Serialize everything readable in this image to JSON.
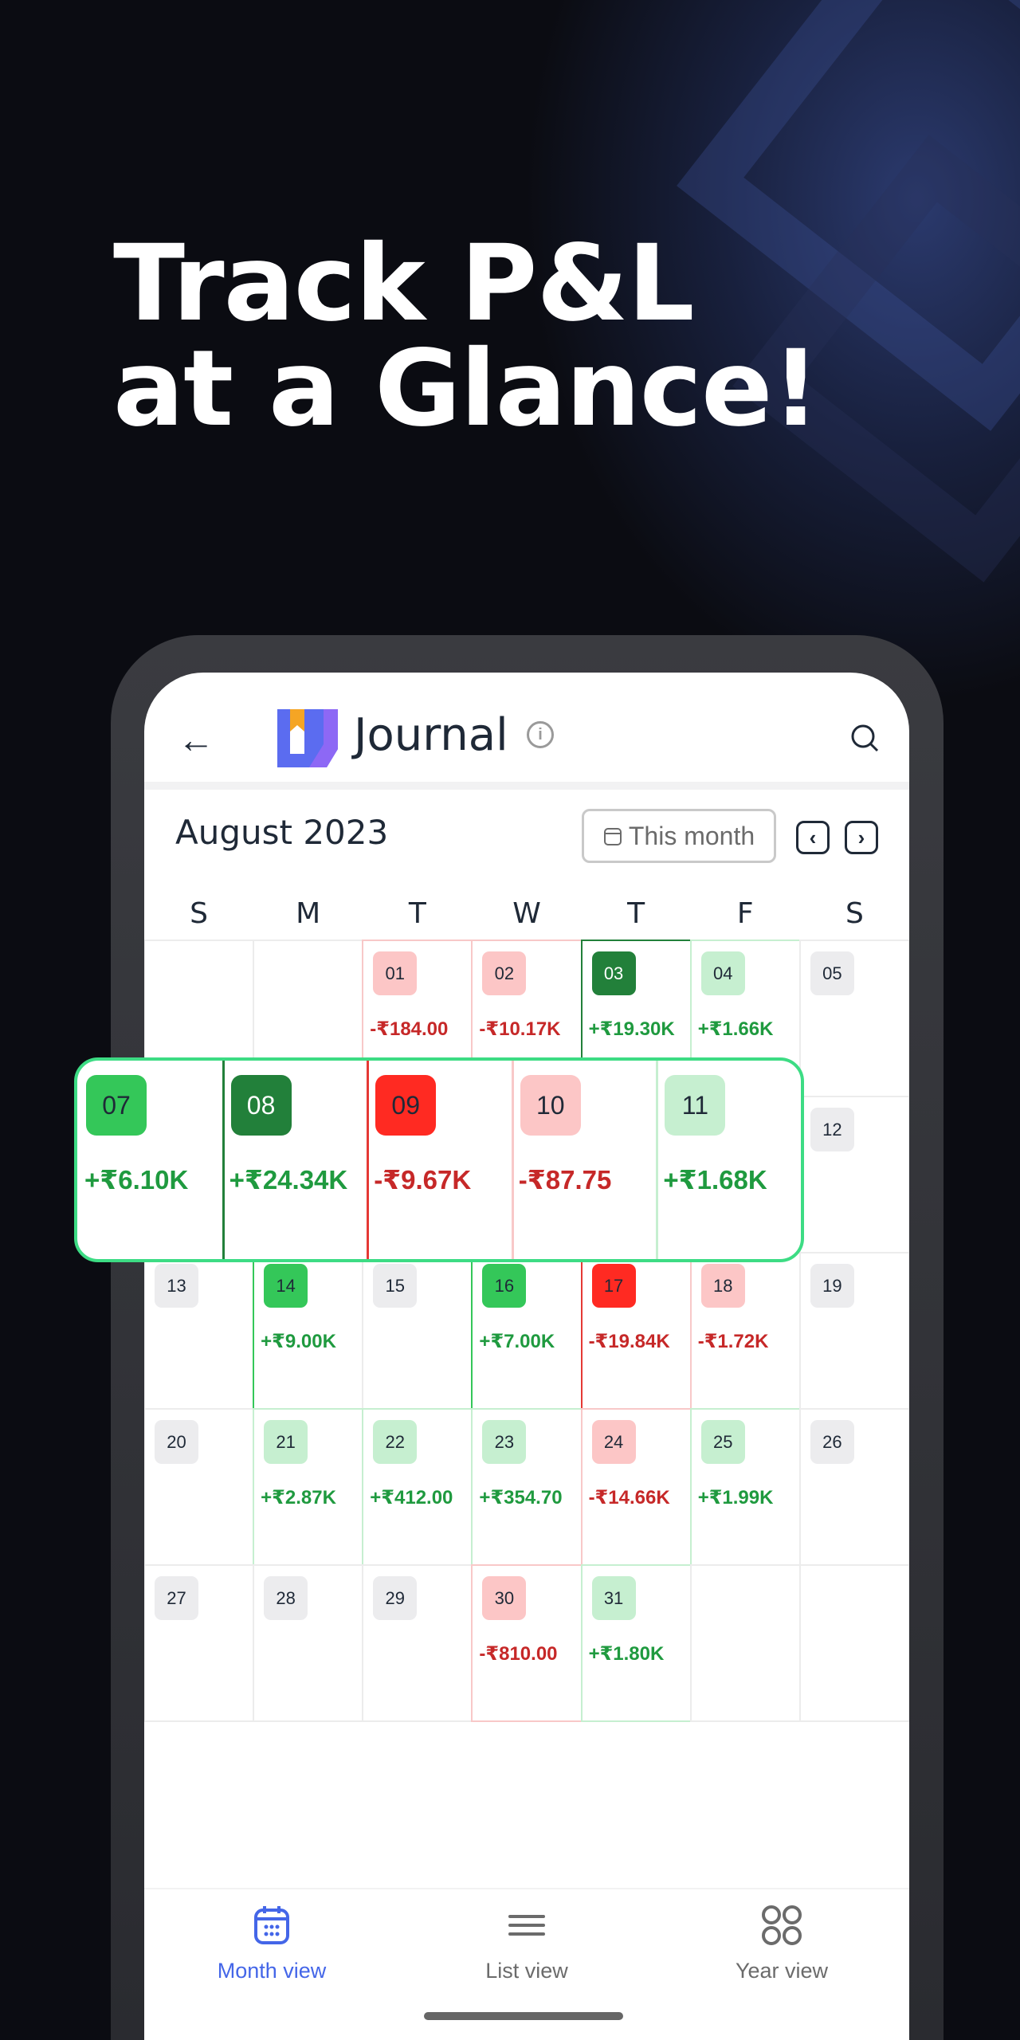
{
  "headline": {
    "line1": "Track P&L",
    "line2": "at a Glance!"
  },
  "header": {
    "title": "Journal",
    "back_icon": "arrow-left-icon",
    "info_icon": "info-icon",
    "search_icon": "search-icon"
  },
  "calendar": {
    "month_label": "August 2023",
    "this_month_label": "This month",
    "weekdays": [
      "S",
      "M",
      "T",
      "W",
      "T",
      "F",
      "S"
    ],
    "colors": {
      "positive": "#1f9a3f",
      "negative": "#c62828"
    },
    "weeks": [
      [
        null,
        null,
        {
          "day": "01",
          "pnl": "-₹184.00",
          "tone": "neg-light"
        },
        {
          "day": "02",
          "pnl": "-₹10.17K",
          "tone": "neg-light"
        },
        {
          "day": "03",
          "pnl": "+₹19.30K",
          "tone": "pos-strong"
        },
        {
          "day": "04",
          "pnl": "+₹1.66K",
          "tone": "pos-light"
        },
        {
          "day": "05",
          "tone": "none"
        }
      ],
      [
        {
          "tone": "hidden"
        },
        {
          "tone": "hidden"
        },
        {
          "tone": "hidden"
        },
        {
          "tone": "hidden"
        },
        {
          "tone": "hidden"
        },
        {
          "tone": "hidden"
        },
        {
          "day": "12",
          "tone": "none"
        }
      ],
      [
        {
          "day": "13",
          "tone": "none"
        },
        {
          "day": "14",
          "pnl": "+₹9.00K",
          "tone": "pos"
        },
        {
          "day": "15",
          "tone": "none"
        },
        {
          "day": "16",
          "pnl": "+₹7.00K",
          "tone": "pos"
        },
        {
          "day": "17",
          "pnl": "-₹19.84K",
          "tone": "neg"
        },
        {
          "day": "18",
          "pnl": "-₹1.72K",
          "tone": "neg-light"
        },
        {
          "day": "19",
          "tone": "none"
        }
      ],
      [
        {
          "day": "20",
          "tone": "none"
        },
        {
          "day": "21",
          "pnl": "+₹2.87K",
          "tone": "pos-light"
        },
        {
          "day": "22",
          "pnl": "+₹412.00",
          "tone": "pos-light"
        },
        {
          "day": "23",
          "pnl": "+₹354.70",
          "tone": "pos-light"
        },
        {
          "day": "24",
          "pnl": "-₹14.66K",
          "tone": "neg-light"
        },
        {
          "day": "25",
          "pnl": "+₹1.99K",
          "tone": "pos-light"
        },
        {
          "day": "26",
          "tone": "none"
        }
      ],
      [
        {
          "day": "27",
          "tone": "none"
        },
        {
          "day": "28",
          "tone": "none"
        },
        {
          "day": "29",
          "tone": "none"
        },
        {
          "day": "30",
          "pnl": "-₹810.00",
          "tone": "neg-light"
        },
        {
          "day": "31",
          "pnl": "+₹1.80K",
          "tone": "pos-light"
        },
        null,
        null
      ]
    ],
    "highlight_week": [
      {
        "day": "07",
        "pnl": "+₹6.10K",
        "tone": "pos"
      },
      {
        "day": "08",
        "pnl": "+₹24.34K",
        "tone": "pos-strong"
      },
      {
        "day": "09",
        "pnl": "-₹9.67K",
        "tone": "neg"
      },
      {
        "day": "10",
        "pnl": "-₹87.75",
        "tone": "neg-light"
      },
      {
        "day": "11",
        "pnl": "+₹1.68K",
        "tone": "pos-light"
      }
    ]
  },
  "bottom_nav": [
    {
      "label": "Month view",
      "icon": "calendar-icon",
      "active": true
    },
    {
      "label": "List view",
      "icon": "list-icon",
      "active": false
    },
    {
      "label": "Year view",
      "icon": "grid-icon",
      "active": false
    }
  ]
}
